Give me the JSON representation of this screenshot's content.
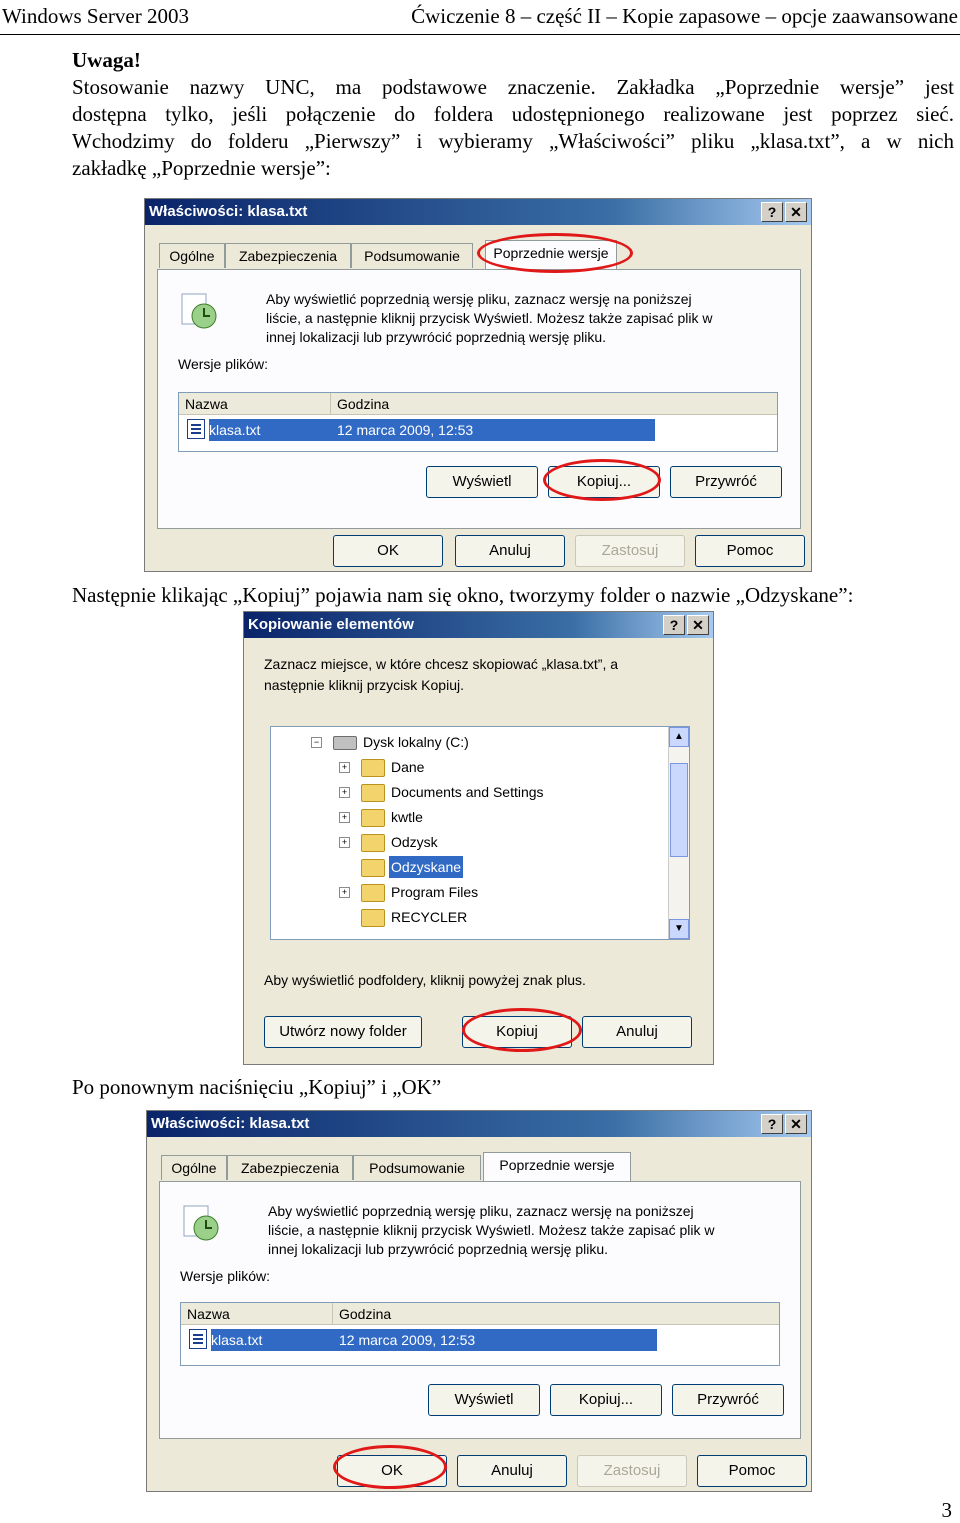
{
  "header": {
    "left": "Windows Server 2003",
    "right": "Ćwiczenie 8 – część II – Kopie zapasowe – opcje zaawansowane"
  },
  "intro": {
    "heading": "Uwaga!",
    "line1": "Stosowanie nazwy UNC, ma podstawowe znaczenie. Zakładka „Poprzednie wersje” jest",
    "line2": "dostępna tylko, jeśli połączenie do foldera udostępnionego realizowane jest poprzez sieć.",
    "line3": "Wchodzimy do folderu „Pierwszy” i wybieramy „Właściwości” pliku „klasa.txt”, a w nich",
    "line4": "zakładkę „Poprzednie wersje”:"
  },
  "dialog1": {
    "title": "Właściwości: klasa.txt",
    "help": "?",
    "close": "✕",
    "tabs": [
      "Ogólne",
      "Zabezpieczenia",
      "Podsumowanie",
      "Poprzednie wersje"
    ],
    "info1": "Aby wyświetlić poprzednią wersję pliku, zaznacz wersję na poniższej",
    "info2": "liście, a następnie kliknij przycisk Wyświetl. Możesz także zapisać plik w",
    "info3": "innej lokalizacji lub przywrócić poprzednią wersję pliku.",
    "versions_label": "Wersje plików:",
    "col_name": "Nazwa",
    "col_time": "Godzina",
    "row_name": "klasa.txt",
    "row_time": "12 marca 2009, 12:53",
    "btn_view": "Wyświetl",
    "btn_copy": "Kopiuj...",
    "btn_restore": "Przywróć",
    "btn_ok": "OK",
    "btn_cancel": "Anuluj",
    "btn_apply": "Zastosuj",
    "btn_help": "Pomoc"
  },
  "text2": "Następnie klikając „Kopiuj” pojawia nam się okno, tworzymy folder o nazwie „Odzyskane”:",
  "dialog2": {
    "title": "Kopiowanie elementów",
    "help": "?",
    "close": "✕",
    "info1": "Zaznacz miejsce, w które chcesz skopiować „klasa.txt”, a",
    "info2": "następnie kliknij przycisk Kopiuj.",
    "tree": [
      "Dysk lokalny (C:)",
      "Dane",
      "Documents and Settings",
      "kwtle",
      "Odzysk",
      "Odzyskane",
      "Program Files",
      "RECYCLER"
    ],
    "hint": "Aby wyświetlić podfoldery, kliknij powyżej znak plus.",
    "btn_new": "Utwórz nowy folder",
    "btn_copy": "Kopiuj",
    "btn_cancel": "Anuluj"
  },
  "text3": "Po ponownym naciśnięciu „Kopiuj” i „OK”",
  "dialog3": {
    "title": "Właściwości: klasa.txt",
    "help": "?",
    "close": "✕",
    "tabs": [
      "Ogólne",
      "Zabezpieczenia",
      "Podsumowanie",
      "Poprzednie wersje"
    ],
    "info1": "Aby wyświetlić poprzednią wersję pliku, zaznacz wersję na poniższej",
    "info2": "liście, a następnie kliknij przycisk Wyświetl. Możesz także zapisać plik w",
    "info3": "innej lokalizacji lub przywrócić poprzednią wersję pliku.",
    "versions_label": "Wersje plików:",
    "col_name": "Nazwa",
    "col_time": "Godzina",
    "row_name": "klasa.txt",
    "row_time": "12 marca 2009, 12:53",
    "btn_view": "Wyświetl",
    "btn_copy": "Kopiuj...",
    "btn_restore": "Przywróć",
    "btn_ok": "OK",
    "btn_cancel": "Anuluj",
    "btn_apply": "Zastosuj",
    "btn_help": "Pomoc"
  },
  "page_number": "3",
  "colors": {
    "highlight_circle": "#e01818",
    "selection": "#316ac5",
    "titlebar": "#0a246a"
  }
}
